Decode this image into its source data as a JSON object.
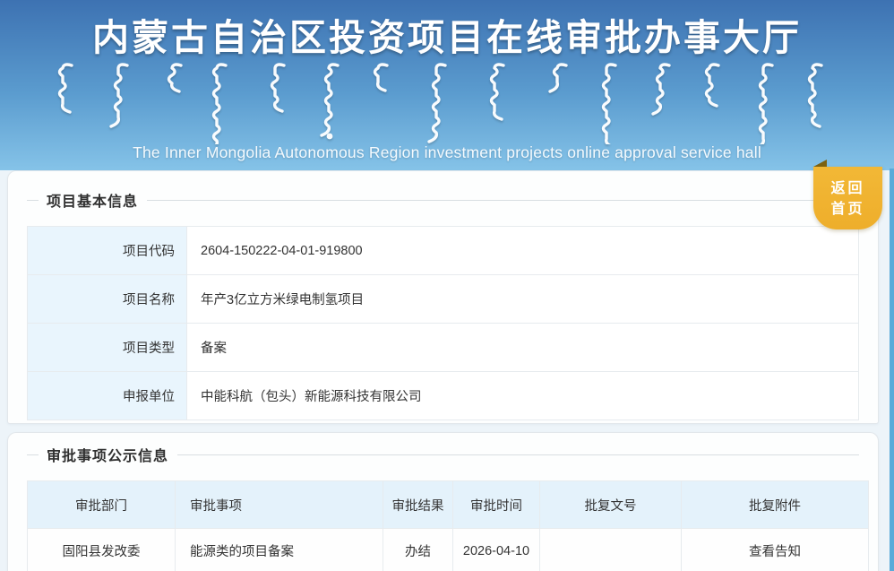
{
  "header": {
    "title_cn": "内蒙古自治区投资项目在线审批办事大厅",
    "subtitle_en": "The Inner Mongolia Autonomous Region investment projects online approval service hall"
  },
  "back_button": {
    "line1": "返回",
    "line2": "首页"
  },
  "basic_info": {
    "section_title": "项目基本信息",
    "rows": [
      {
        "label": "项目代码",
        "value": "2604-150222-04-01-919800"
      },
      {
        "label": "项目名称",
        "value": "年产3亿立方米绿电制氢项目"
      },
      {
        "label": "项目类型",
        "value": "备案"
      },
      {
        "label": "申报单位",
        "value": "中能科航（包头）新能源科技有限公司"
      }
    ]
  },
  "approval_info": {
    "section_title": "审批事项公示信息",
    "columns": [
      "审批部门",
      "审批事项",
      "审批结果",
      "审批时间",
      "批复文号",
      "批复附件"
    ],
    "rows": [
      {
        "department": "固阳县发改委",
        "item": "能源类的项目备案",
        "result": "办结",
        "time": "2026-04-10",
        "doc_no": "",
        "attachment": "查看告知"
      }
    ]
  },
  "colors": {
    "header_gradient_top": "#3d72b2",
    "header_gradient_bottom": "#85c3e8",
    "label_cell_bg": "#e9f5fd",
    "table_header_bg": "#e4f2fb",
    "ribbon_bg": "#f0b330",
    "right_strip": "#5aabd9",
    "text": "#333333"
  }
}
